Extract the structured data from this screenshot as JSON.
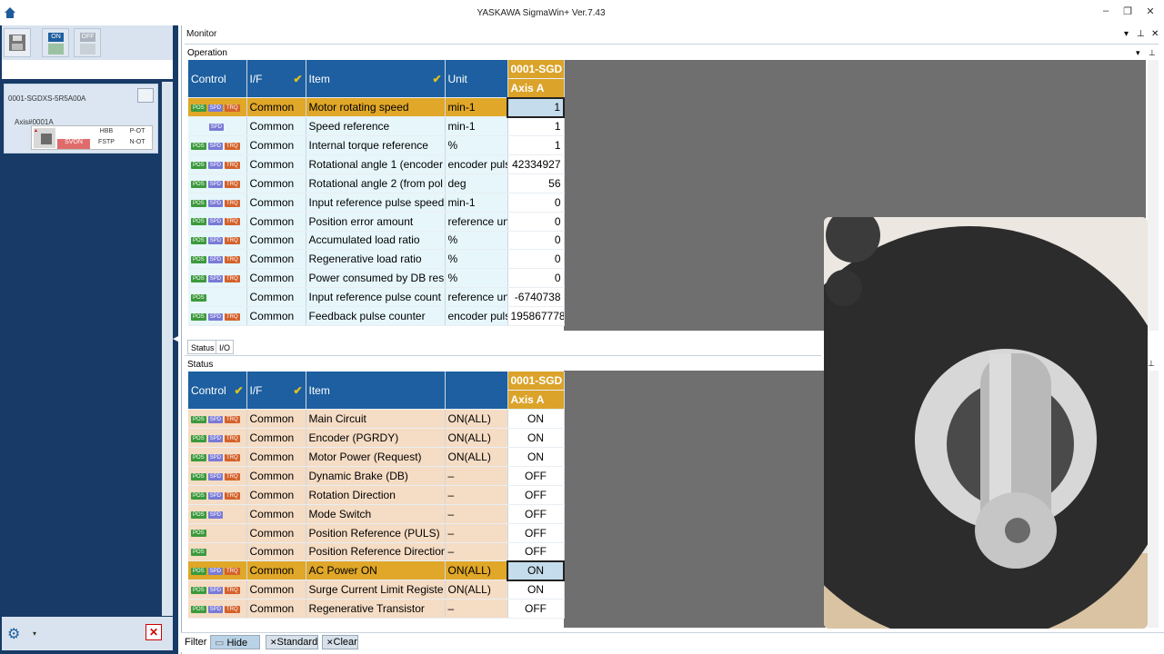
{
  "window": {
    "title": "YASKAWA SigmaWin+ Ver.7.43"
  },
  "toolbar": {
    "on_label": "ON",
    "off_label": "OFF"
  },
  "device": {
    "name": "0001-SGDXS-5R5A00A",
    "axis": "Axis#0001A",
    "cells": [
      "HBB",
      "P-OT",
      "SVON",
      "FSTP",
      "N-OT"
    ]
  },
  "monitor": {
    "title": "Monitor",
    "subtitle": "Operation"
  },
  "operation": {
    "headers": {
      "control": "Control",
      "if": "I/F",
      "item": "Item",
      "unit": "Unit",
      "axis_id": "0001-SGD",
      "axis_name": "Axis A"
    },
    "rows": [
      {
        "tags": [
          "POS",
          "SPD",
          "TRQ"
        ],
        "if": "Common",
        "item": "Motor rotating speed",
        "unit": "min-1",
        "value": "1"
      },
      {
        "tags": [
          "SPD"
        ],
        "if": "Common",
        "item": "Speed reference",
        "unit": "min-1",
        "value": "1"
      },
      {
        "tags": [
          "POS",
          "SPD",
          "TRQ"
        ],
        "if": "Common",
        "item": "Internal torque reference",
        "unit": "%",
        "value": "1"
      },
      {
        "tags": [
          "POS",
          "SPD",
          "TRQ"
        ],
        "if": "Common",
        "item": "Rotational angle 1 (encoder",
        "unit": "encoder puls",
        "value": "42334927"
      },
      {
        "tags": [
          "POS",
          "SPD",
          "TRQ"
        ],
        "if": "Common",
        "item": "Rotational angle 2 (from pol",
        "unit": "deg",
        "value": "56"
      },
      {
        "tags": [
          "POS",
          "SPD",
          "TRQ"
        ],
        "if": "Common",
        "item": "Input reference pulse speed",
        "unit": "min-1",
        "value": "0"
      },
      {
        "tags": [
          "POS",
          "SPD",
          "TRQ"
        ],
        "if": "Common",
        "item": "Position error amount",
        "unit": "reference un",
        "value": "0"
      },
      {
        "tags": [
          "POS",
          "SPD",
          "TRQ"
        ],
        "if": "Common",
        "item": "Accumulated load ratio",
        "unit": "%",
        "value": "0"
      },
      {
        "tags": [
          "POS",
          "SPD",
          "TRQ"
        ],
        "if": "Common",
        "item": "Regenerative load ratio",
        "unit": "%",
        "value": "0"
      },
      {
        "tags": [
          "POS",
          "SPD",
          "TRQ"
        ],
        "if": "Common",
        "item": "Power consumed by DB resi",
        "unit": "%",
        "value": "0"
      },
      {
        "tags": [
          "POS"
        ],
        "if": "Common",
        "item": "Input reference pulse count",
        "unit": "reference un",
        "value": "-6740738"
      },
      {
        "tags": [
          "POS",
          "SPD",
          "TRQ"
        ],
        "if": "Common",
        "item": "Feedback pulse counter",
        "unit": "encoder puls",
        "value": "195867778"
      }
    ]
  },
  "tabs": {
    "status": "Status",
    "io": "I/O"
  },
  "status": {
    "title": "Status",
    "headers": {
      "control": "Control",
      "if": "I/F",
      "item": "Item",
      "axis_id": "0001-SGD",
      "axis_name": "Axis A"
    },
    "rows": [
      {
        "tags": [
          "POS",
          "SPD",
          "TRQ"
        ],
        "if": "Common",
        "item": "Main Circuit",
        "cond": "ON(ALL)",
        "value": "ON"
      },
      {
        "tags": [
          "POS",
          "SPD",
          "TRQ"
        ],
        "if": "Common",
        "item": "Encoder (PGRDY)",
        "cond": "ON(ALL)",
        "value": "ON"
      },
      {
        "tags": [
          "POS",
          "SPD",
          "TRQ"
        ],
        "if": "Common",
        "item": "Motor Power (Request)",
        "cond": "ON(ALL)",
        "value": "ON"
      },
      {
        "tags": [
          "POS",
          "SPD",
          "TRQ"
        ],
        "if": "Common",
        "item": "Dynamic Brake (DB)",
        "cond": "–",
        "value": "OFF"
      },
      {
        "tags": [
          "POS",
          "SPD",
          "TRQ"
        ],
        "if": "Common",
        "item": "Rotation Direction",
        "cond": "–",
        "value": "OFF"
      },
      {
        "tags": [
          "POS",
          "SPD"
        ],
        "if": "Common",
        "item": "Mode Switch",
        "cond": "–",
        "value": "OFF"
      },
      {
        "tags": [
          "POS"
        ],
        "if": "Common",
        "item": "Position Reference (PULS)",
        "cond": "–",
        "value": "OFF"
      },
      {
        "tags": [
          "POS"
        ],
        "if": "Common",
        "item": "Position Reference Direction",
        "cond": "–",
        "value": "OFF"
      },
      {
        "tags": [
          "POS",
          "SPD",
          "TRQ"
        ],
        "if": "Common",
        "item": "AC Power ON",
        "cond": "ON(ALL)",
        "value": "ON"
      },
      {
        "tags": [
          "POS",
          "SPD",
          "TRQ"
        ],
        "if": "Common",
        "item": "Surge Current Limit Registe",
        "cond": "ON(ALL)",
        "value": "ON"
      },
      {
        "tags": [
          "POS",
          "SPD",
          "TRQ"
        ],
        "if": "Common",
        "item": "Regenerative Transistor",
        "cond": "–",
        "value": "OFF"
      }
    ]
  },
  "filter": {
    "label": "Filter",
    "hide": "Hide",
    "standard": "Standard",
    "clear": "Clear"
  },
  "colors": {
    "header_blue": "#1d5fa0",
    "axis_gold": "#dba32a",
    "selected_row": "#e0a728",
    "panel_navy": "#173a66"
  }
}
